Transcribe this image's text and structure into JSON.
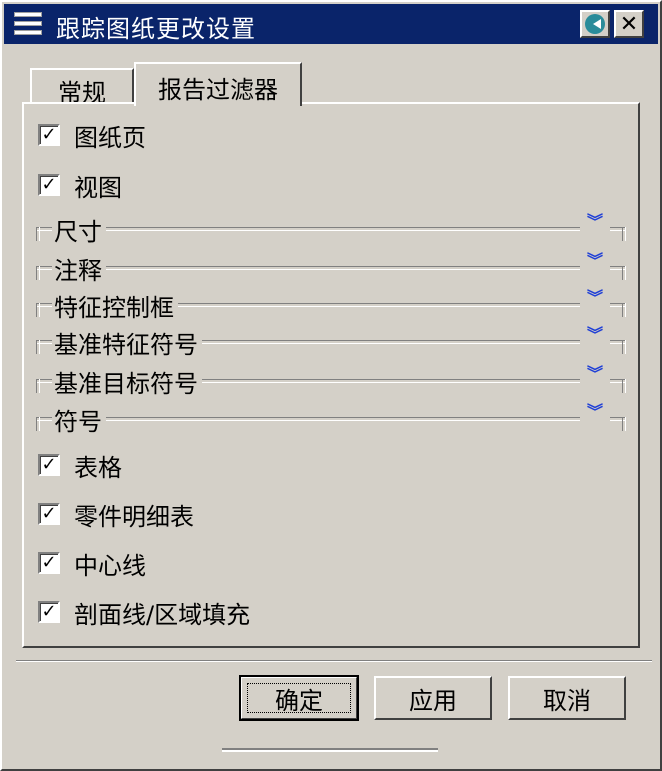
{
  "window": {
    "title": "跟踪图纸更改设置"
  },
  "tabs": [
    {
      "label": "常规",
      "active": false
    },
    {
      "label": "报告过滤器",
      "active": true
    }
  ],
  "checks_top": [
    {
      "label": "图纸页",
      "checked": true
    },
    {
      "label": "视图",
      "checked": true
    }
  ],
  "groups": [
    {
      "label": "尺寸",
      "icon": "expand-chevron-icon"
    },
    {
      "label": "注释",
      "icon": "expand-chevron-icon"
    },
    {
      "label": "特征控制框",
      "icon": "expand-chevron-icon"
    },
    {
      "label": "基准特征符号",
      "icon": "expand-chevron-icon"
    },
    {
      "label": "基准目标符号",
      "icon": "expand-chevron-icon"
    },
    {
      "label": "符号",
      "icon": "expand-chevron-icon"
    }
  ],
  "checks_bottom": [
    {
      "label": "表格",
      "checked": true
    },
    {
      "label": "零件明细表",
      "checked": true
    },
    {
      "label": "中心线",
      "checked": true
    },
    {
      "label": "剖面线/区域填充",
      "checked": true
    }
  ],
  "buttons": {
    "ok": "确定",
    "apply": "应用",
    "cancel": "取消"
  },
  "colors": {
    "titlebar": "#0a246a",
    "face": "#d4d0c8",
    "expand_icon": "#1f3fd6"
  }
}
